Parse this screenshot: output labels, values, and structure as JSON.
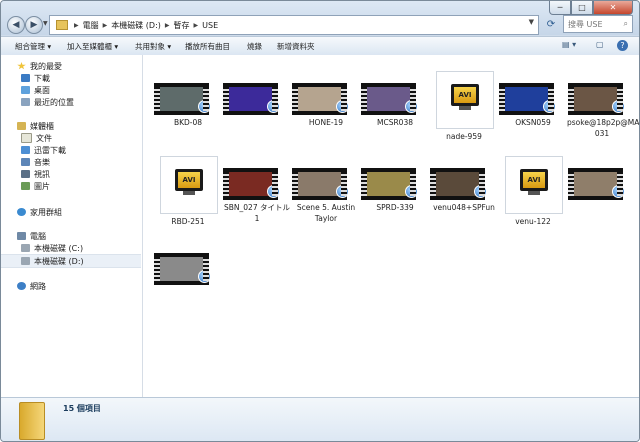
{
  "window_controls": {
    "minimize": "─",
    "maximize": "□",
    "close": "✕"
  },
  "nav_buttons": {
    "back": "◀",
    "forward": "▶",
    "dropdown": "▼"
  },
  "address": {
    "crumbs": [
      "電腦",
      "本機磁碟 (D:)",
      "暫存",
      "USE"
    ],
    "separator": "▶",
    "dropdown": "▼"
  },
  "refresh_icon": "⟳",
  "search": {
    "placeholder": "搜尋 USE",
    "icon": "search-icon",
    "glyph": "⌕"
  },
  "toolbar": {
    "organize": "組合管理 ▾",
    "add_to_library": "加入至媒體櫃 ▾",
    "share": "共用對象 ▾",
    "play_all": "播放所有曲目",
    "burn": "燒錄",
    "new_folder": "新增資料夾",
    "view_glyph": "▤ ▾",
    "preview_glyph": "▢",
    "help_glyph": "?"
  },
  "nav": {
    "favorites": "我的最愛",
    "downloads": "下載",
    "desktop": "桌面",
    "recent": "最近的位置",
    "libraries": "媒體櫃",
    "documents": "文件",
    "thunder": "迅雷下載",
    "music": "音樂",
    "videos": "視訊",
    "pictures": "圖片",
    "homegroup": "家用群組",
    "computer": "電腦",
    "drive_c": "本機磁碟 (C:)",
    "drive_d": "本機磁碟 (D:)",
    "network": "網路"
  },
  "files": [
    {
      "name": "BKD-08",
      "type": "film",
      "color": "#5e6b6a"
    },
    {
      "name": "",
      "type": "film",
      "color": "#3c2a9a"
    },
    {
      "name": "HONE-19",
      "type": "film",
      "color": "#b5a48f"
    },
    {
      "name": "MCSR038",
      "type": "film",
      "color": "#6a5a8a"
    },
    {
      "name": "nade-959",
      "type": "avi"
    },
    {
      "name": "OKSN059",
      "type": "film",
      "color": "#1f3f9c"
    },
    {
      "name": "psoke@18p2p@MACA-031",
      "type": "film",
      "color": "#6b5645"
    },
    {
      "name": "RBD-251",
      "type": "avi"
    },
    {
      "name": "SBN_027 タイトル 1",
      "type": "film",
      "color": "#7a2a22"
    },
    {
      "name": "Scene 5. Austin Taylor",
      "type": "film",
      "color": "#8a7a6a"
    },
    {
      "name": "SPRD-339",
      "type": "film",
      "color": "#9a8a4a"
    },
    {
      "name": "venu048+SPFun",
      "type": "film",
      "color": "#5a4a3a"
    },
    {
      "name": "venu-122",
      "type": "avi"
    },
    {
      "name": "",
      "type": "film",
      "color": "#8f7e6a"
    },
    {
      "name": "",
      "type": "film",
      "color": "#8a8a8a"
    }
  ],
  "avi_label": "AVI",
  "status": {
    "count": "15 個項目"
  }
}
